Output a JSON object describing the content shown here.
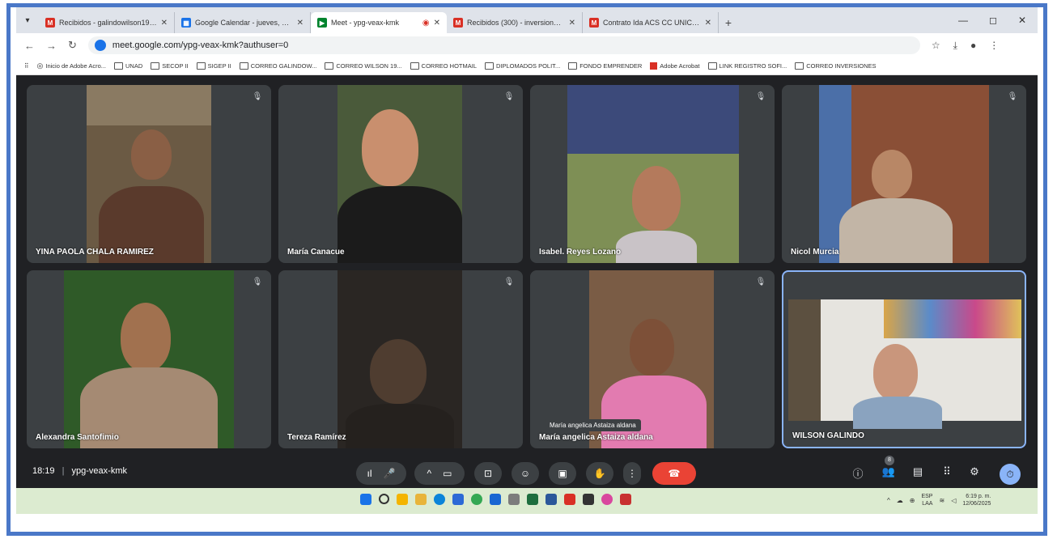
{
  "tabs": [
    {
      "title": "Recibidos - galindowilson1971@g...",
      "favicon": "gmail-icon",
      "color": "#d93025"
    },
    {
      "title": "Google Calendar - jueves, 12 de j...",
      "favicon": "calendar-icon",
      "color": "#1a73e8"
    },
    {
      "title": "Meet - ypg-veax-kmk",
      "favicon": "meet-icon",
      "color": "#00832d"
    },
    {
      "title": "Recibidos (300) - inversionesjmyh...",
      "favicon": "gmail-icon",
      "color": "#d93025"
    },
    {
      "title": "Contrato Ida ACS CC UNICENTRO...",
      "favicon": "gmail-icon",
      "color": "#d93025"
    }
  ],
  "address": {
    "url": "meet.google.com/ypg-veax-kmk?authuser=0"
  },
  "bookmarks": [
    "Inicio de Adobe Acro...",
    "UNAD",
    "SECOP II",
    "SIGEP II",
    "CORREO GALINDOW...",
    "CORREO WILSON 19...",
    "CORREO HOTMAIL",
    "DIPLOMADOS POLIT...",
    "FONDO EMPRENDER",
    "Adobe Acrobat",
    "LINK REGISTRO SOFI...",
    "CORREO INVERSIONES"
  ],
  "participants": [
    {
      "name": "YINA PAOLA CHALA RAMIREZ",
      "bg": "#6b5a44",
      "skin": "#8a5f45",
      "shirt": "#5a3a2c"
    },
    {
      "name": "María Canacue",
      "bg": "#4a5a3a",
      "skin": "#c98f6e",
      "shirt": "#1b1b1b"
    },
    {
      "name": "Isabel. Reyes Lozano",
      "bg": "#7e8f55",
      "skin": "#b47a5c",
      "shirt": "#c9c3c7"
    },
    {
      "name": "Nicol Murcia",
      "bg": "#8a4f36",
      "skin": "#b88766",
      "shirt": "#c2b5a6"
    },
    {
      "name": "Alexandra Santofimio",
      "bg": "#2f5a28",
      "skin": "#a1714f",
      "shirt": "#a58a73"
    },
    {
      "name": "Tereza Ramírez",
      "bg": "#2a2623",
      "skin": "#4f3d30",
      "shirt": "#25211e"
    },
    {
      "name": "María angelica Astaiza aldana",
      "bg": "#7a5c45",
      "skin": "#7d5038",
      "shirt": "#e27bb0"
    },
    {
      "name": "WILSON GALINDO",
      "bg": "#e6e4df",
      "skin": "#c9967c",
      "shirt": "#8aa3bf"
    }
  ],
  "tooltip": "María angelica Astaiza aldana",
  "meeting": {
    "time": "18:19",
    "separator": "|",
    "code": "ypg-veax-kmk"
  },
  "participant_count": "8",
  "tray": {
    "lang_top": "ESP",
    "lang_bottom": "LAA",
    "time": "6:19 p. m.",
    "date": "12/06/2025"
  }
}
